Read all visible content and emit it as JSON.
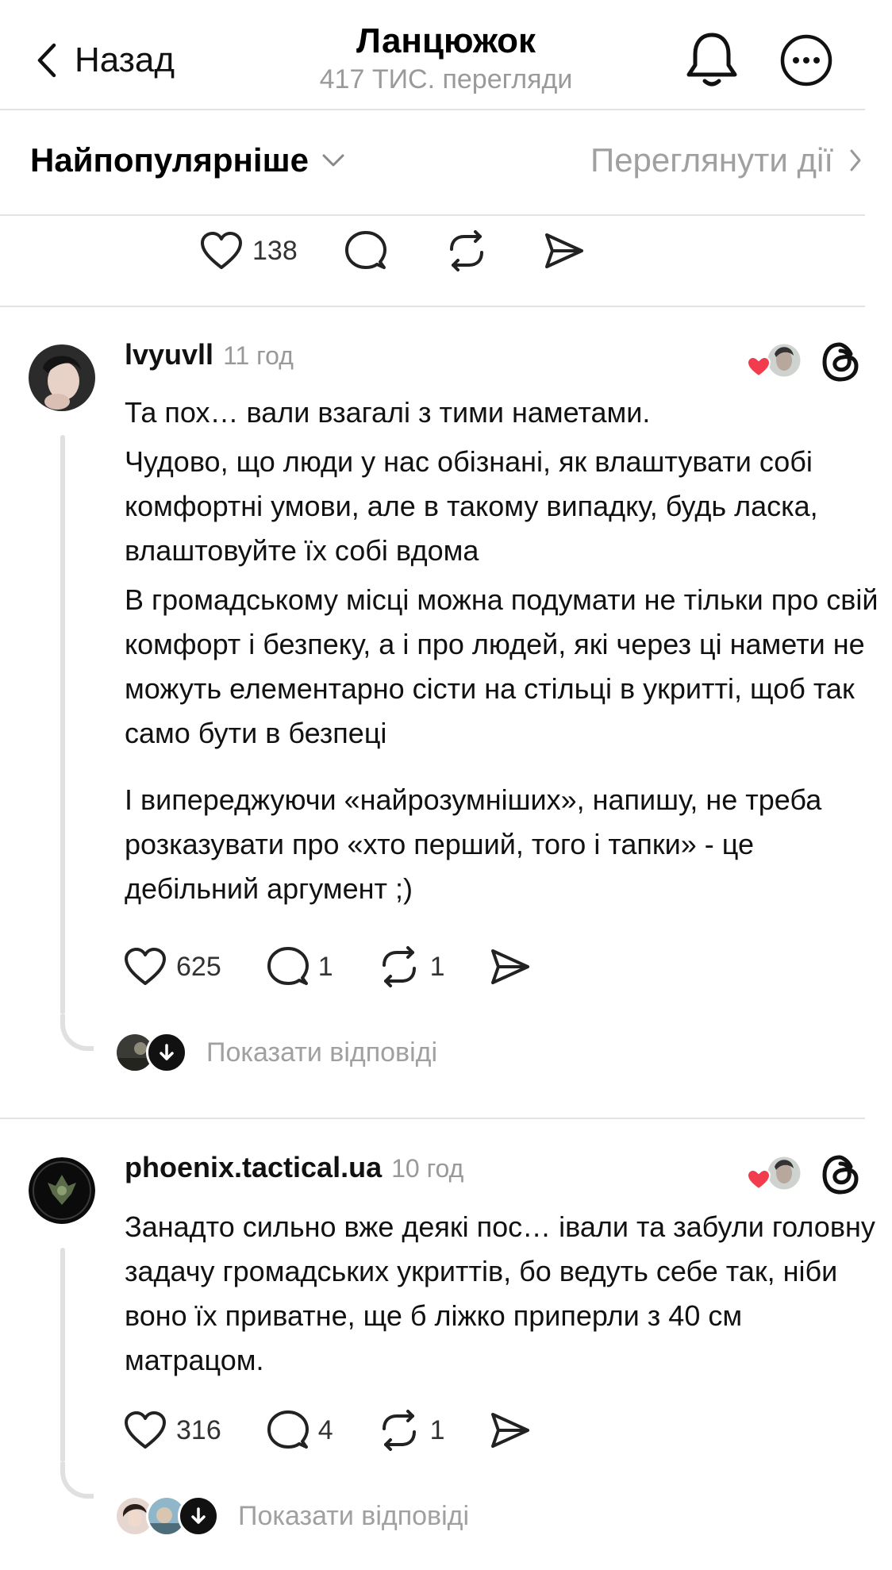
{
  "header": {
    "back_label": "Назад",
    "title": "Ланцюжок",
    "subtitle": "417 ТИС. перегляди"
  },
  "sort_bar": {
    "sort_label": "Найпопулярніше",
    "view_actions_label": "Переглянути дії"
  },
  "top_actions": {
    "likes": "138"
  },
  "posts": [
    {
      "username": "lvyuvll",
      "time": "11 год",
      "paragraphs": [
        "Та пох… вали взагалі з тими наметами.",
        "Чудово, що люди у нас обізнані, як влаштувати собі комфортні умови, але в такому випадку, будь ласка, влаштовуйте їх собі вдома",
        "В громадському місці можна подумати не тільки про свій комфорт і безпеку, а і про людей, які через ці намети не можуть елементарно сісти на стільці в укритті, щоб так само бути в безпеці",
        "І випереджуючи «найрозумніших», напишу, не треба розказувати про «хто перший, того і тапки» - це дебільний аргумент ;)"
      ],
      "likes": "625",
      "comments": "1",
      "reposts": "1",
      "show_replies": "Показати відповіді"
    },
    {
      "username": "phoenix.tactical.ua",
      "time": "10 год",
      "paragraphs": [
        "Занадто сильно вже деякі пос… івали та забули головну задачу громадських укриттів, бо ведуть себе так, ніби воно їх приватне, ще б ліжко приперли з 40 см матрацом."
      ],
      "likes": "316",
      "comments": "4",
      "reposts": "1",
      "show_replies": "Показати відповіді"
    }
  ],
  "icons": {
    "back": "chevron-left-icon",
    "bell": "bell-icon",
    "more": "more-horizontal-icon",
    "heart": "heart-icon",
    "comment": "comment-icon",
    "repost": "repost-icon",
    "share": "share-icon",
    "threads": "threads-logo-icon"
  },
  "colors": {
    "like_red": "#f23b4d",
    "muted_text": "#9a9a9a",
    "divider": "#e3e3e3"
  }
}
